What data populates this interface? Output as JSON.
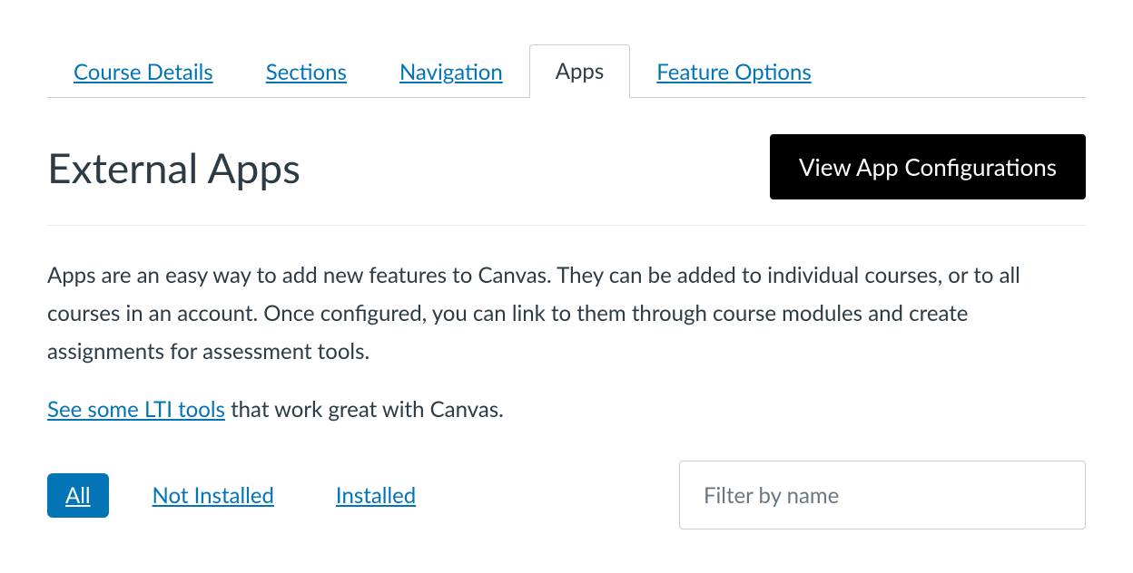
{
  "tabs": {
    "course_details": "Course Details",
    "sections": "Sections",
    "navigation": "Navigation",
    "apps": "Apps",
    "feature_options": "Feature Options"
  },
  "header": {
    "title": "External Apps",
    "view_config_button": "View App Configurations"
  },
  "body": {
    "description": "Apps are an easy way to add new features to Canvas. They can be added to individual courses, or to all courses in an account. Once configured, you can link to them through course modules and create assignments for assessment tools.",
    "lti_link_text": "See some LTI tools",
    "lti_suffix": " that work great with Canvas."
  },
  "filters": {
    "all": "All",
    "not_installed": "Not Installed",
    "installed": "Installed",
    "search_placeholder": "Filter by name"
  }
}
